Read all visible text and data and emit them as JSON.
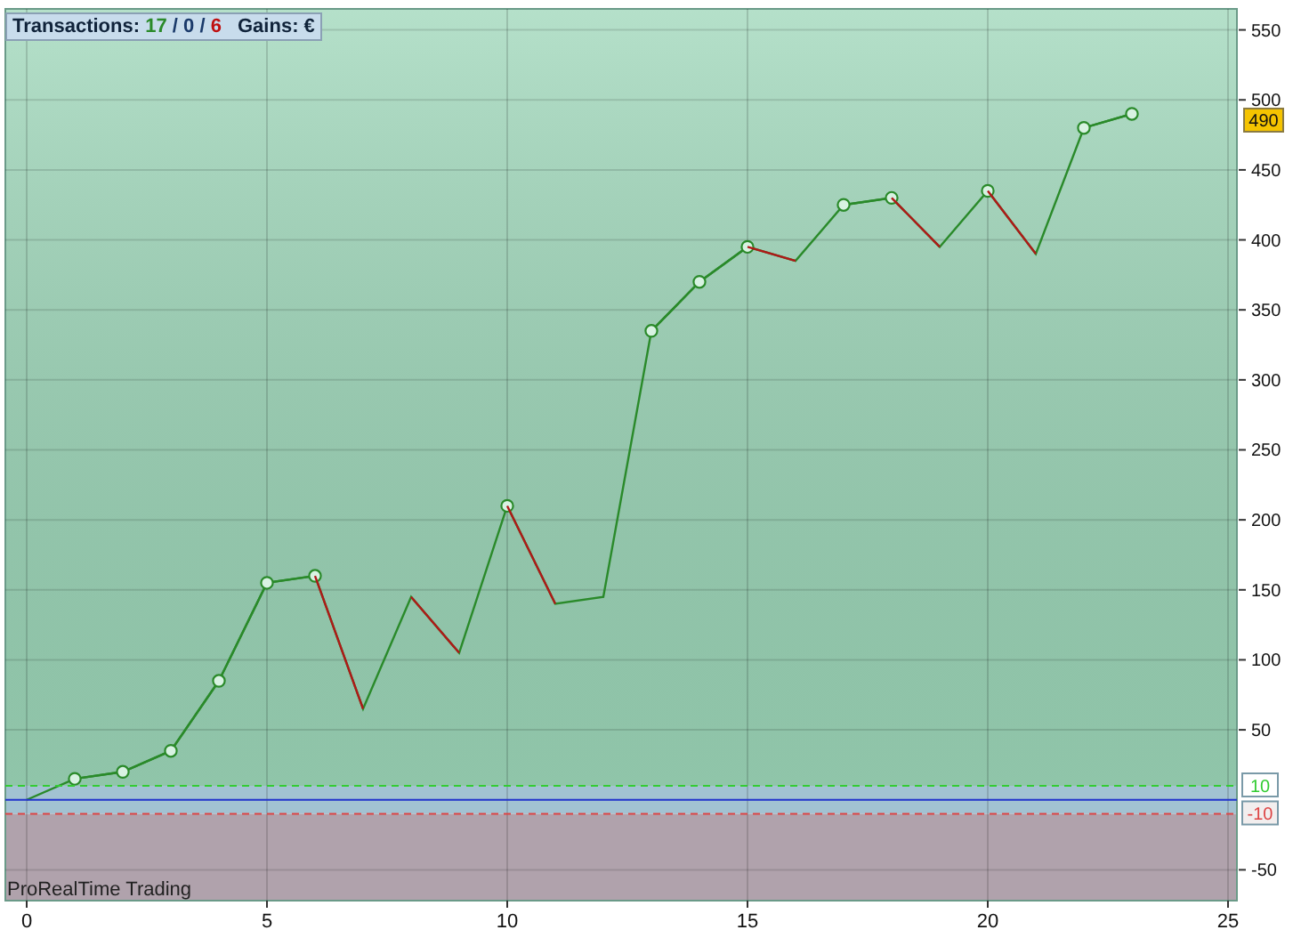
{
  "summary": {
    "label": "Transactions:",
    "counts": [
      {
        "text": "17",
        "color": "#2a8a2a"
      },
      {
        "text": "/",
        "color": "#1a3a6a"
      },
      {
        "text": "0",
        "color": "#1a3a6a"
      },
      {
        "text": "/",
        "color": "#1a3a6a"
      },
      {
        "text": "6",
        "color": "#c01010"
      }
    ],
    "gains": "Gains: €"
  },
  "chart_data": {
    "type": "line",
    "x": [
      0,
      1,
      2,
      3,
      4,
      5,
      6,
      7,
      8,
      9,
      10,
      11,
      12,
      13,
      14,
      15,
      16,
      17,
      18,
      19,
      20,
      21,
      22,
      23
    ],
    "series": [
      {
        "color": "#2a8a2a",
        "values": [
          0,
          15,
          20,
          35,
          85,
          155,
          160,
          65,
          145,
          105,
          210,
          140,
          145,
          335,
          370,
          395,
          385,
          425,
          430,
          395,
          435,
          390,
          480,
          490
        ]
      },
      {
        "color": "#2a8a2a",
        "values": [
          null,
          15,
          20,
          35,
          85,
          155,
          160,
          null,
          null,
          null,
          210,
          null,
          null,
          335,
          370,
          395,
          null,
          425,
          430,
          null,
          435,
          null,
          480,
          490
        ]
      }
    ],
    "xlim": [
      0,
      25
    ],
    "ylim": [
      -72,
      565
    ],
    "xticks": [
      0,
      5,
      10,
      15,
      20,
      25
    ],
    "yticks": [
      -50,
      50,
      100,
      150,
      200,
      250,
      300,
      350,
      400,
      450,
      500,
      550
    ],
    "grid": true
  },
  "zones": [
    {
      "color": "#9cd6b8"
    },
    {
      "color": "#a2c2d2"
    },
    {
      "color": "#b0a2ac"
    }
  ],
  "level_labels": [
    {
      "label": "10",
      "color": "#33cc33"
    },
    {
      "label": "-10",
      "color": "#dd4444"
    }
  ],
  "last_value": "490",
  "footer": "ProRealTime Trading"
}
